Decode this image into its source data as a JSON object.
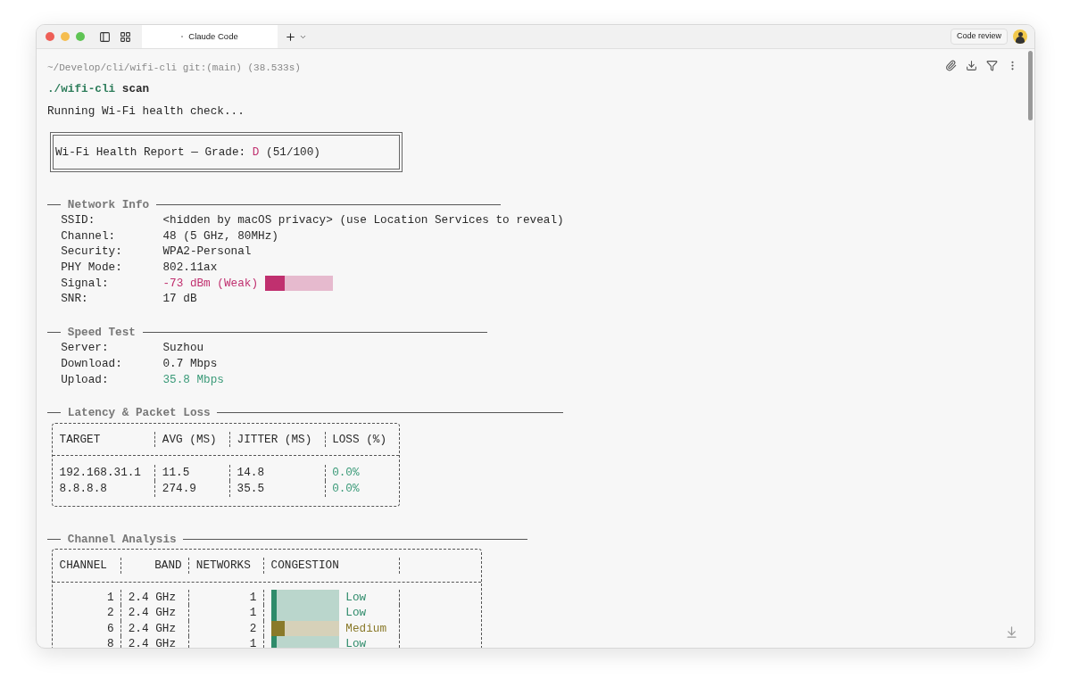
{
  "window": {
    "tab_title": "Claude Code",
    "review_button": "Code review"
  },
  "terminal": {
    "prompt": "~/Develop/cli/wifi-cli git:(main) (38.533s)",
    "command": "./wifi-cli",
    "argument": "scan",
    "status": "Running Wi-Fi health check...",
    "report": {
      "prefix": "Wi-Fi Health Report — Grade: ",
      "grade": "D",
      "suffix": " (51/100)"
    },
    "sections": [
      {
        "title": "Network Info",
        "kind": "fields",
        "fields": [
          {
            "label": "SSID:",
            "value": "<hidden by macOS privacy> (use Location Services to reveal)"
          },
          {
            "label": "Channel:",
            "value": "48 (5 GHz, 80MHz)"
          },
          {
            "label": "Security:",
            "value": "WPA2-Personal"
          },
          {
            "label": "PHY Mode:",
            "value": "802.11ax"
          },
          {
            "label": "Signal:",
            "value": "-73 dBm (Weak)",
            "color": "#c0306f",
            "level": 0.29
          },
          {
            "label": "SNR:",
            "value": "17 dB"
          }
        ]
      },
      {
        "title": "Speed Test",
        "kind": "fields",
        "fields": [
          {
            "label": "Server:",
            "value": "Suzhou"
          },
          {
            "label": "Download:",
            "value": "0.7 Mbps"
          },
          {
            "label": "Upload:",
            "value": "35.8 Mbps",
            "color": "#3a9a78"
          }
        ]
      },
      {
        "title": "Latency & Packet Loss",
        "kind": "latency",
        "columns": [
          "TARGET",
          "AVG (MS)",
          "JITTER (MS)",
          "LOSS (%)"
        ],
        "rows": [
          {
            "target": "192.168.31.1",
            "avg": "11.5",
            "jitter": "14.8",
            "loss": "0.0%",
            "color": "#3a9a78"
          },
          {
            "target": "8.8.8.8",
            "avg": "274.9",
            "jitter": "35.5",
            "loss": "0.0%",
            "color": "#3a9a78"
          }
        ]
      },
      {
        "title": "Channel Analysis",
        "kind": "channels",
        "columns": [
          "CHANNEL",
          "BAND",
          "NETWORKS",
          "CONGESTION"
        ],
        "rows": [
          {
            "channel": "1",
            "band": "2.4 GHz",
            "networks": "1",
            "congestion": "Low",
            "color": "#2e8b6a",
            "level": 0.08
          },
          {
            "channel": "2",
            "band": "2.4 GHz",
            "networks": "1",
            "congestion": "Low",
            "color": "#2e8b6a",
            "level": 0.08
          },
          {
            "channel": "6",
            "band": "2.4 GHz",
            "networks": "2",
            "congestion": "Medium",
            "color": "#8a7a2a",
            "level": 0.2
          },
          {
            "channel": "8",
            "band": "2.4 GHz",
            "networks": "1",
            "congestion": "Low",
            "color": "#2e8b6a",
            "level": 0.08
          }
        ]
      }
    ]
  }
}
